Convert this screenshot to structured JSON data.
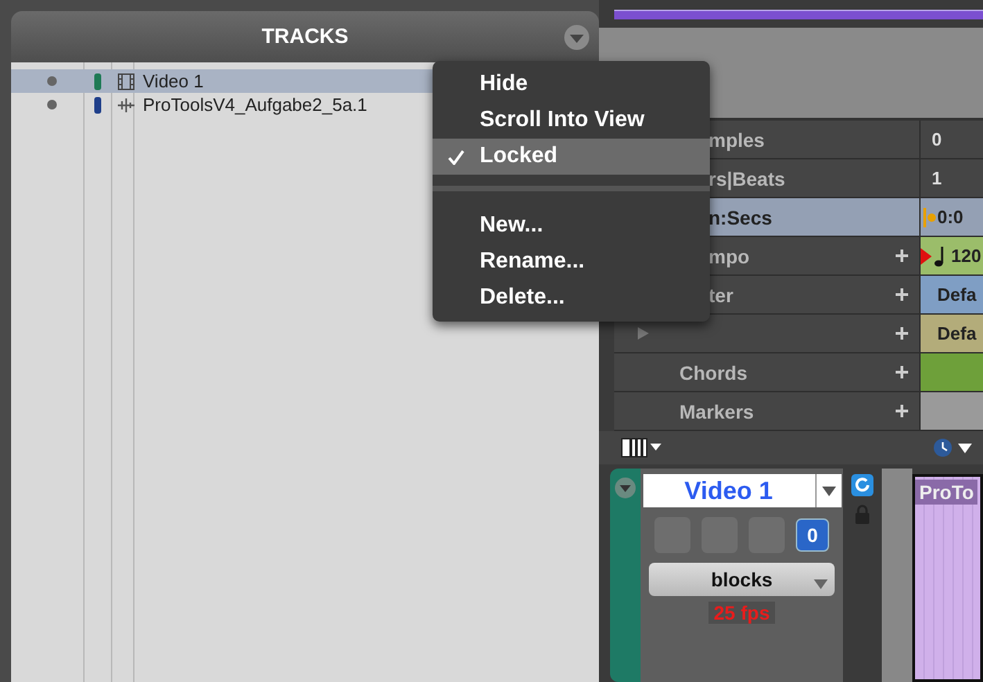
{
  "tracks_panel": {
    "title": "TRACKS",
    "tracks": [
      {
        "name": "Video 1",
        "kind": "video",
        "color": "#1e7a55",
        "selected": true
      },
      {
        "name": "ProToolsV4_Aufgabe2_5a.1",
        "kind": "audio",
        "color": "#1f3f8a",
        "selected": false
      }
    ]
  },
  "context_menu": {
    "items": [
      {
        "kind": "item",
        "label": "Hide",
        "checked": false,
        "selected": false
      },
      {
        "kind": "item",
        "label": "Scroll Into View",
        "checked": false,
        "selected": false
      },
      {
        "kind": "item",
        "label": "Locked",
        "checked": true,
        "selected": true
      },
      {
        "kind": "separator"
      },
      {
        "kind": "item",
        "label": "New...",
        "checked": false,
        "selected": false
      },
      {
        "kind": "item",
        "label": "Rename...",
        "checked": false,
        "selected": false
      },
      {
        "kind": "item",
        "label": "Delete...",
        "checked": false,
        "selected": false
      }
    ]
  },
  "rulers": [
    {
      "label": "mples",
      "covered": true,
      "selected": false,
      "value": "0",
      "kind": "plain",
      "addable": false
    },
    {
      "label": "rs|Beats",
      "covered": true,
      "selected": false,
      "value": "1",
      "kind": "plain",
      "addable": false
    },
    {
      "label": "n:Secs",
      "covered": true,
      "selected": true,
      "value": "0:0",
      "kind": "time",
      "addable": false
    },
    {
      "label": "mpo",
      "covered": true,
      "selected": false,
      "value": "120",
      "kind": "tempo",
      "addable": true,
      "color": "#9bbd6a"
    },
    {
      "label": "ter",
      "covered": true,
      "selected": false,
      "value": "Defa",
      "kind": "band",
      "addable": true,
      "color": "#7f9ec4"
    },
    {
      "covered": true,
      "selected": false,
      "value": "Defa",
      "kind": "band",
      "addable": true,
      "color": "#b3ac7a",
      "expandable": true
    },
    {
      "label": "Chords",
      "covered": false,
      "selected": false,
      "kind": "band",
      "addable": true,
      "color": "#6ea03a"
    },
    {
      "label": "Markers",
      "covered": false,
      "selected": false,
      "kind": "band",
      "addable": true,
      "color": "#9a9a9a"
    }
  ],
  "video_track": {
    "name": "Video 1",
    "voice": "0",
    "mode": "blocks",
    "frame_rate": "25 fps",
    "clip_label": "ProTo"
  }
}
